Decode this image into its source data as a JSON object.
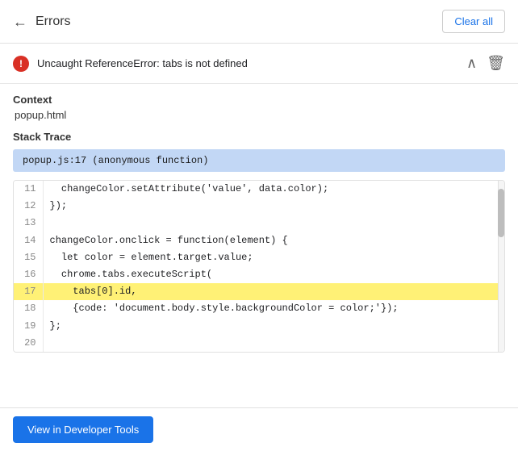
{
  "header": {
    "back_label": "←",
    "title": "Errors",
    "clear_all_label": "Clear all"
  },
  "error": {
    "icon_label": "!",
    "message": "Uncaught ReferenceError: tabs is not defined",
    "chevron": "∧",
    "trash": "🗑"
  },
  "context": {
    "label": "Context",
    "value": "popup.html"
  },
  "stack_trace": {
    "label": "Stack Trace",
    "highlight": "popup.js:17 (anonymous function)"
  },
  "code_lines": [
    {
      "num": "11",
      "code": "  changeColor.setAttribute('value', data.color);",
      "highlighted": false
    },
    {
      "num": "12",
      "code": "});",
      "highlighted": false
    },
    {
      "num": "13",
      "code": "",
      "highlighted": false
    },
    {
      "num": "14",
      "code": "changeColor.onclick = function(element) {",
      "highlighted": false
    },
    {
      "num": "15",
      "code": "  let color = element.target.value;",
      "highlighted": false
    },
    {
      "num": "16",
      "code": "  chrome.tabs.executeScript(",
      "highlighted": false
    },
    {
      "num": "17",
      "code": "    tabs[0].id,",
      "highlighted": true
    },
    {
      "num": "18",
      "code": "    {code: 'document.body.style.backgroundColor = color;'});",
      "highlighted": false
    },
    {
      "num": "19",
      "code": "};",
      "highlighted": false
    },
    {
      "num": "20",
      "code": "",
      "highlighted": false
    }
  ],
  "bottom_button": {
    "label": "View in Developer Tools"
  }
}
